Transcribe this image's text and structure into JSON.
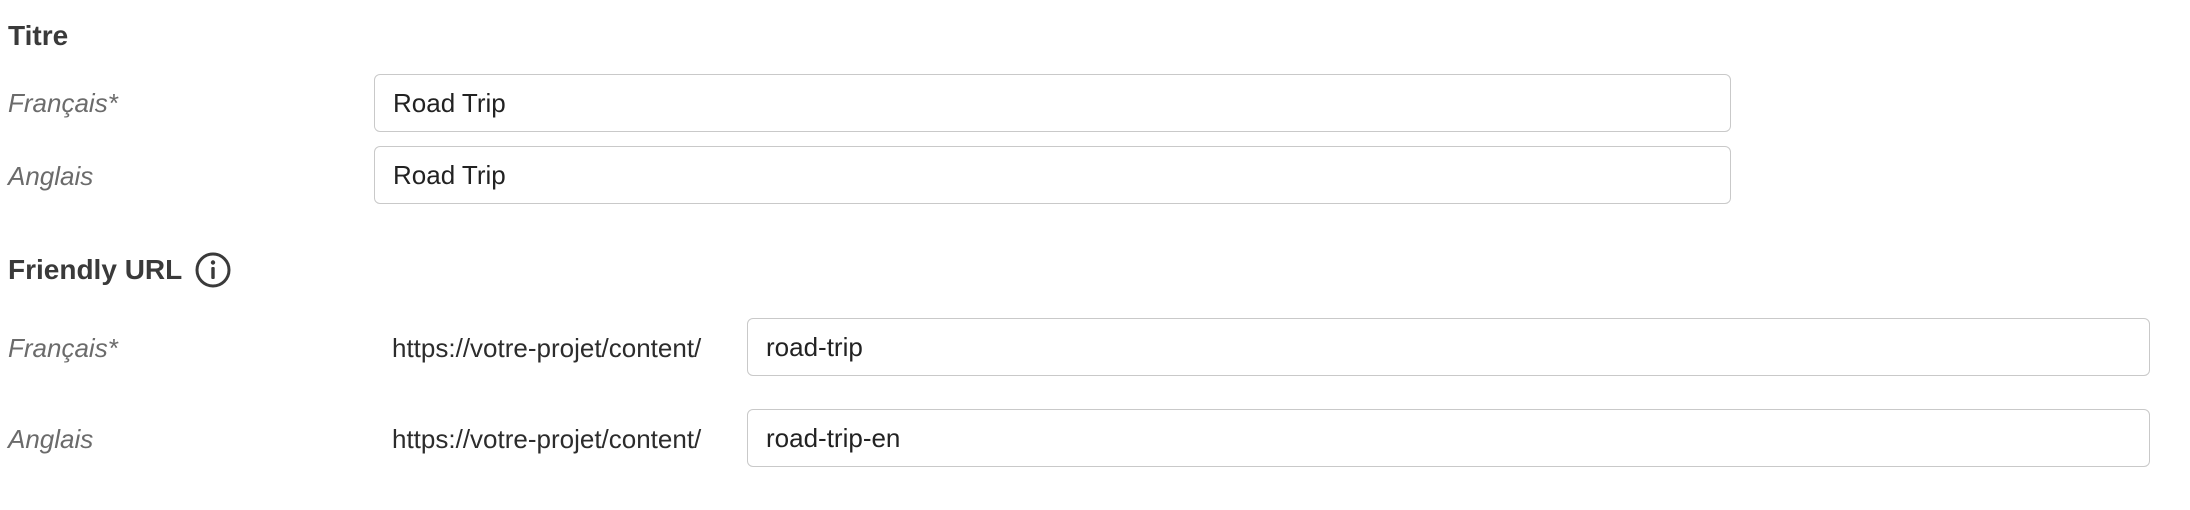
{
  "title_section": {
    "heading": "Titre",
    "rows": [
      {
        "label": "Français*",
        "value": "Road Trip"
      },
      {
        "label": "Anglais",
        "value": "Road Trip"
      }
    ]
  },
  "friendly_url_section": {
    "heading": "Friendly URL",
    "info_icon": "info-circle-icon",
    "rows": [
      {
        "label": "Français*",
        "prefix": "https://votre-projet/content/",
        "value": "road-trip"
      },
      {
        "label": "Anglais",
        "prefix": "https://votre-projet/content/",
        "value": "road-trip-en"
      }
    ]
  }
}
